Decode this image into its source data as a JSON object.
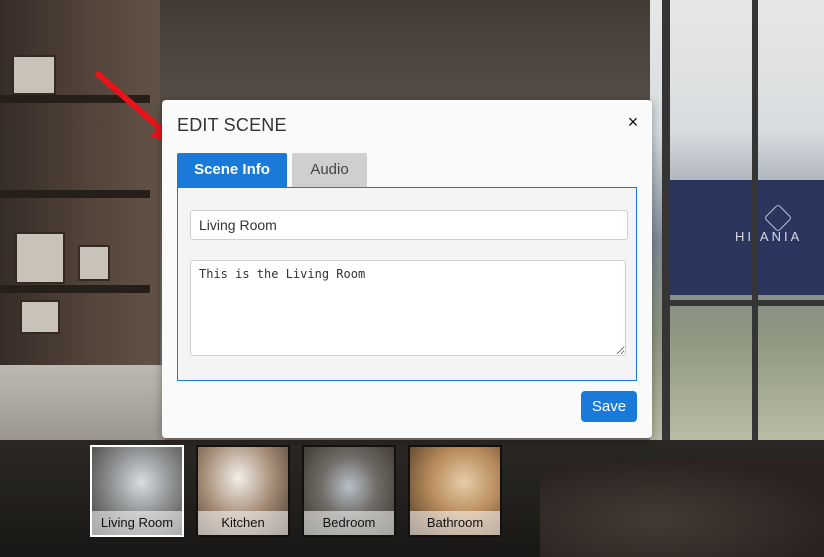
{
  "background": {
    "building_sign": "HI  ANIA"
  },
  "modal": {
    "title": "EDIT SCENE",
    "close_symbol": "×",
    "tabs": [
      {
        "label": "Scene Info",
        "active": true
      },
      {
        "label": "Audio",
        "active": false
      }
    ],
    "scene_info": {
      "name_value": "Living Room",
      "description_value": "This is the Living Room"
    },
    "save_label": "Save"
  },
  "scenes": [
    {
      "label": "Living Room",
      "selected": true
    },
    {
      "label": "Kitchen",
      "selected": false
    },
    {
      "label": "Bedroom",
      "selected": false
    },
    {
      "label": "Bathroom",
      "selected": false
    }
  ],
  "colors": {
    "accent": "#1a7ad9",
    "arrow": "#e8141a",
    "inactive_tab": "#cfcfcf"
  },
  "icons": {
    "close": "close-icon",
    "annotation": "red-arrow-icon"
  }
}
